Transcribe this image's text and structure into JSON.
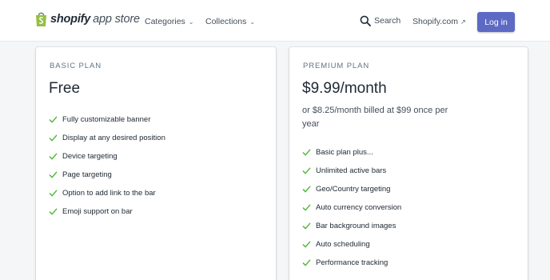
{
  "header": {
    "brand": "shopify",
    "brand_suffix": "app store",
    "nav": [
      {
        "label": "Categories",
        "icon": "chevron-down-icon"
      },
      {
        "label": "Collections",
        "icon": "chevron-down-icon"
      }
    ],
    "search_label": "Search",
    "shopify_link": "Shopify.com",
    "login_label": "Log in"
  },
  "plans": {
    "basic": {
      "label": "BASIC PLAN",
      "price": "Free",
      "features": [
        "Fully customizable banner",
        "Display at any desired position",
        "Device targeting",
        "Page targeting",
        "Option to add link to the bar",
        "Emoji support on bar"
      ]
    },
    "premium": {
      "label": "PREMIUM PLAN",
      "price": "$9.99/month",
      "note": "or $8.25/month billed at $99 once per year",
      "features": [
        "Basic plan plus...",
        "Unlimited active bars",
        "Geo/Country targeting",
        "Auto currency conversion",
        "Bar background images",
        "Auto scheduling",
        "Performance tracking"
      ]
    }
  },
  "colors": {
    "brand_green": "#95bf47",
    "check_green": "#50b83c",
    "button": "#5c6ac4",
    "background": "#f4f6f8"
  }
}
